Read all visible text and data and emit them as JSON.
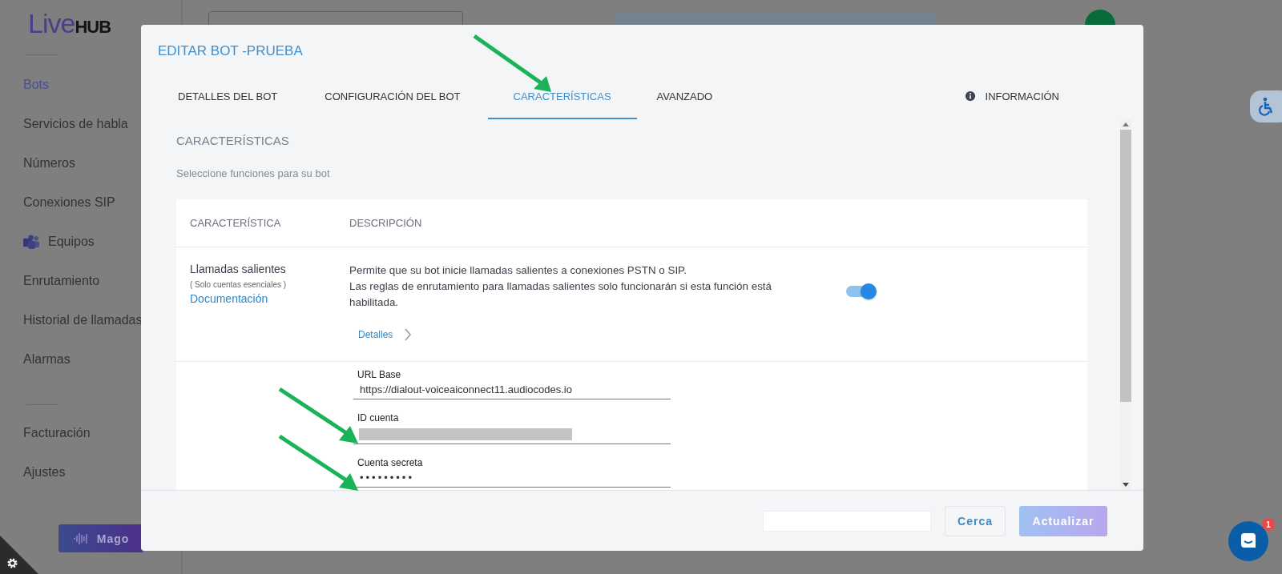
{
  "sidebar": {
    "logo_left": "Live",
    "logo_right": "HUB",
    "items": [
      {
        "label": "Bots",
        "selected": true,
        "kind": "plain"
      },
      {
        "label": "Servicios de habla",
        "selected": false,
        "kind": "plain"
      },
      {
        "label": "Números",
        "selected": false,
        "kind": "plain"
      },
      {
        "label": "Conexiones SIP",
        "selected": false,
        "kind": "plain"
      },
      {
        "label": "Equipos",
        "selected": false,
        "kind": "teams"
      },
      {
        "label": "Enrutamiento",
        "selected": false,
        "kind": "plain"
      },
      {
        "label": "Historial de llamadas",
        "selected": false,
        "kind": "plain"
      },
      {
        "label": "Alarmas",
        "selected": false,
        "kind": "plain"
      }
    ],
    "bottom_items": [
      {
        "label": "Facturación",
        "selected": false
      },
      {
        "label": "Ajustes",
        "selected": false
      }
    ],
    "wizard_button": "Mago"
  },
  "dialog": {
    "title": "EDITAR BOT -PRUEBA",
    "tabs": [
      {
        "label": "DETALLES DEL BOT",
        "selected": false
      },
      {
        "label": "CONFIGURACIÓN DEL BOT",
        "selected": false
      },
      {
        "label": "CARACTERÍSTICAS",
        "selected": true
      },
      {
        "label": "AVANZADO",
        "selected": false
      }
    ],
    "info_tab": "INFORMACIÓN",
    "section_title": "CARACTERÍSTICAS",
    "section_subtitle": "Seleccione funciones para su bot",
    "table": {
      "columns": [
        "CARACTERÍSTICA",
        "DESCRIPCIÓN"
      ],
      "rows": [
        {
          "name": "Llamadas salientes",
          "note": "( Solo cuentas esenciales )",
          "link": "Documentación",
          "description": [
            "Permite que su bot inicie llamadas salientes a conexiones PSTN o SIP.",
            "Las reglas de enrutamiento para llamadas salientes solo funcionarán si esta función está habilitada."
          ],
          "details": "Detalles",
          "on": true,
          "fields": [
            {
              "label": "URL Base",
              "kind": "text",
              "value": "https://dialout-voiceaiconnect11.audiocodes.io"
            },
            {
              "label": "ID cuenta",
              "kind": "redacted"
            },
            {
              "label": "Cuenta secreta",
              "kind": "password",
              "value": "•••••••••"
            }
          ]
        }
      ]
    },
    "buttons": [
      {
        "label": "Cerca",
        "kind": "secondary",
        "disabled": false
      },
      {
        "label": "Actualizar",
        "kind": "primary",
        "disabled": true
      }
    ]
  },
  "chat": {
    "badge": "1"
  }
}
